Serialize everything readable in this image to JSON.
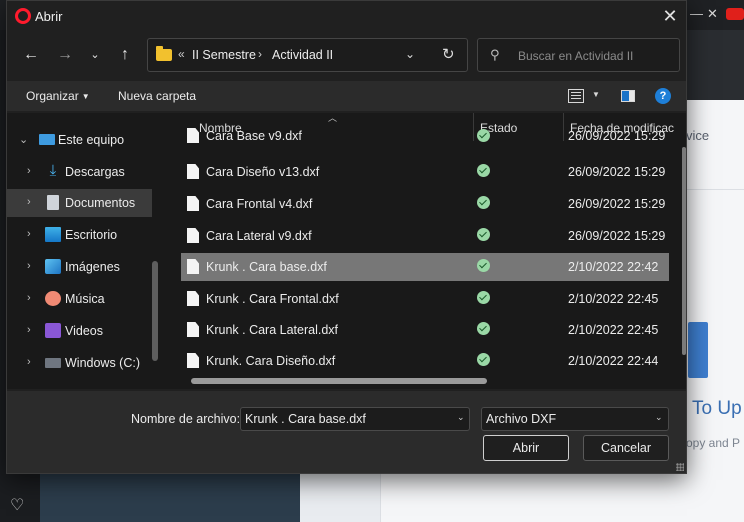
{
  "dialog": {
    "title": "Abrir",
    "close_glyph": "✕"
  },
  "nav": {
    "breadcrumb_sep_start": "«",
    "breadcrumb": [
      "II Semestre",
      "Actividad II"
    ],
    "breadcrumb_sep": "›",
    "search_placeholder": "Buscar en Actividad II"
  },
  "toolbar": {
    "organize_label": "Organizar",
    "new_folder_label": "Nueva carpeta",
    "help_glyph": "?"
  },
  "sidebar": {
    "items": [
      {
        "label": "Este equipo",
        "icon": "computer-icon",
        "expanded": true
      },
      {
        "label": "Descargas",
        "icon": "download-icon"
      },
      {
        "label": "Documentos",
        "icon": "documents-icon",
        "selected": true
      },
      {
        "label": "Escritorio",
        "icon": "desktop-icon"
      },
      {
        "label": "Imágenes",
        "icon": "pictures-icon"
      },
      {
        "label": "Música",
        "icon": "music-icon"
      },
      {
        "label": "Videos",
        "icon": "videos-icon"
      },
      {
        "label": "Windows (C:)",
        "icon": "drive-icon"
      }
    ]
  },
  "filelist": {
    "columns": {
      "name": "Nombre",
      "state": "Estado",
      "date": "Fecha de modificac"
    },
    "rows": [
      {
        "name": "Cara Base v9.dxf",
        "date": "26/09/2022 15:29",
        "state": "synced"
      },
      {
        "name": "Cara Diseño v13.dxf",
        "date": "26/09/2022 15:29",
        "state": "synced"
      },
      {
        "name": "Cara Frontal v4.dxf",
        "date": "26/09/2022 15:29",
        "state": "synced"
      },
      {
        "name": "Cara Lateral v9.dxf",
        "date": "26/09/2022 15:29",
        "state": "synced"
      },
      {
        "name": "Krunk . Cara base.dxf",
        "date": "2/10/2022 22:42",
        "state": "synced",
        "selected": true
      },
      {
        "name": "Krunk . Cara Frontal.dxf",
        "date": "2/10/2022 22:45",
        "state": "synced"
      },
      {
        "name": "Krunk . Cara Lateral.dxf",
        "date": "2/10/2022 22:45",
        "state": "synced"
      },
      {
        "name": "Krunk. Cara Diseño.dxf",
        "date": "2/10/2022 22:44",
        "state": "synced"
      }
    ]
  },
  "footer": {
    "filename_label": "Nombre de archivo:",
    "filename_value": "Krunk . Cara base.dxf",
    "filetype_value": "Archivo DXF",
    "open_label": "Abrir",
    "cancel_label": "Cancelar"
  },
  "background": {
    "text_vice": "vice",
    "text_toup": "To Up",
    "text_copy": "opy and P"
  },
  "colors": {
    "accent": "#1e7fd8",
    "brand_opera": "#ff1b2d",
    "selection": "#777777"
  }
}
